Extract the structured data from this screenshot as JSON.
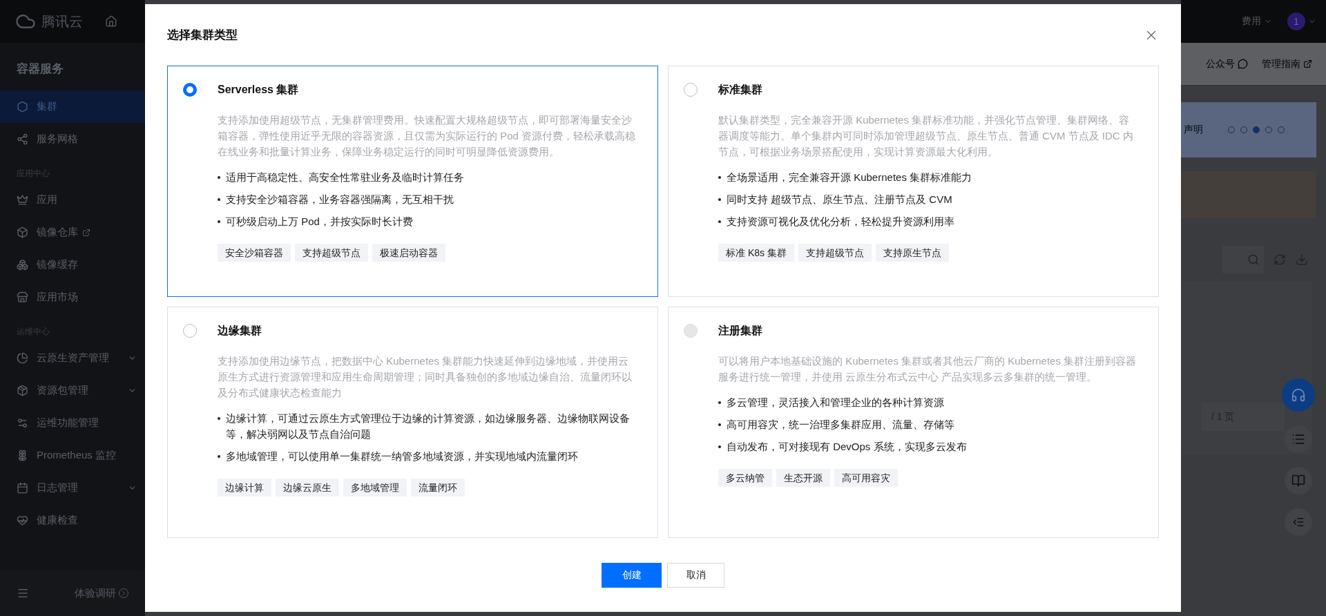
{
  "sidebar": {
    "brand": "腾讯云",
    "title": "容器服务",
    "items": [
      {
        "kind": "item",
        "label": "集群",
        "selected": true,
        "external": false,
        "expandable": false
      },
      {
        "kind": "item",
        "label": "服务网格",
        "selected": false,
        "external": false,
        "expandable": false
      },
      {
        "kind": "group",
        "label": "应用中心"
      },
      {
        "kind": "item",
        "label": "应用",
        "selected": false,
        "external": false,
        "expandable": false
      },
      {
        "kind": "item",
        "label": "镜像仓库",
        "selected": false,
        "external": true,
        "expandable": false
      },
      {
        "kind": "item",
        "label": "镜像缓存",
        "selected": false,
        "external": false,
        "expandable": false
      },
      {
        "kind": "item",
        "label": "应用市场",
        "selected": false,
        "external": false,
        "expandable": false
      },
      {
        "kind": "group",
        "label": "运维中心"
      },
      {
        "kind": "item",
        "label": "云原生资产管理",
        "selected": false,
        "external": false,
        "expandable": true
      },
      {
        "kind": "item",
        "label": "资源包管理",
        "selected": false,
        "external": false,
        "expandable": true
      },
      {
        "kind": "item",
        "label": "运维功能管理",
        "selected": false,
        "external": false,
        "expandable": false
      },
      {
        "kind": "item",
        "label": "Prometheus 监控",
        "selected": false,
        "external": false,
        "expandable": false
      },
      {
        "kind": "item",
        "label": "日志管理",
        "selected": false,
        "external": false,
        "expandable": true
      },
      {
        "kind": "item",
        "label": "健康检查",
        "selected": false,
        "external": false,
        "expandable": false
      }
    ],
    "footer": "体验调研"
  },
  "dialog": {
    "title": "选择集群类型",
    "options": [
      {
        "title": "Serverless 集群",
        "selected": true,
        "disabled": false,
        "description": "支持添加使用超级节点，无集群管理费用。快速配置大规格超级节点，即可部署海量安全沙箱容器，弹性使用近乎无限的容器资源，且仅需为实际运行的 Pod 资源付费，轻松承载高稳在线业务和批量计算业务，保障业务稳定运行的同时可明显降低资源费用。",
        "features": [
          "适用于高稳定性、高安全性常驻业务及临时计算任务",
          "支持安全沙箱容器，业务容器强隔离，无互相干扰",
          "可秒级启动上万 Pod，并按实际时长计费"
        ],
        "tags": [
          "安全沙箱容器",
          "支持超级节点",
          "极速启动容器"
        ]
      },
      {
        "title": "标准集群",
        "selected": false,
        "disabled": false,
        "description": "默认集群类型，完全兼容开源 Kubernetes 集群标准功能，并强化节点管理、集群网络、容器调度等能力。单个集群内可同时添加管理超级节点、原生节点、普通 CVM 节点及 IDC 内节点，可根据业务场景搭配使用，实现计算资源最大化利用。",
        "features": [
          "全场景适用，完全兼容开源 Kubernetes 集群标准能力",
          "同时支持 超级节点、原生节点、注册节点及 CVM",
          "支持资源可视化及优化分析，轻松提升资源利用率"
        ],
        "tags": [
          "标准 K8s 集群",
          "支持超级节点",
          "支持原生节点"
        ]
      },
      {
        "title": "边缘集群",
        "selected": false,
        "disabled": false,
        "description": "支持添加使用边缘节点，把数据中心 Kubernetes 集群能力快速延伸到边缘地域，并使用云原生方式进行资源管理和应用生命周期管理；同时具备独创的多地域边缘自治、流量闭环以及分布式健康状态检查能力",
        "features": [
          "边缘计算，可通过云原生方式管理位于边缘的计算资源，如边缘服务器、边缘物联网设备等，解决弱网以及节点自治问题",
          "多地域管理，可以使用单一集群统一纳管多地域资源，并实现地域内流量闭环"
        ],
        "tags": [
          "边缘计算",
          "边缘云原生",
          "多地域管理",
          "流量闭环"
        ]
      },
      {
        "title": "注册集群",
        "selected": false,
        "disabled": true,
        "description": "可以将用户本地基础设施的 Kubernetes 集群或者其他云厂商的 Kubernetes 集群注册到容器服务进行统一管理，并使用 云原生分布式云中心 产品实现多云多集群的统一管理。",
        "features": [
          "多云管理，灵活接入和管理企业的各种计算资源",
          "高可用容灾，统一治理多集群应用、流量、存储等",
          "自动发布，可对接现有 DevOps 系统，实现多云发布"
        ],
        "tags": [
          "多云纳管",
          "生态开源",
          "高可用容灾"
        ]
      }
    ],
    "buttons": [
      {
        "label": "创建",
        "primary": true
      },
      {
        "label": "取消",
        "primary": false
      }
    ]
  },
  "background": {
    "menu": "费用",
    "avatar": "1",
    "links": [
      {
        "label": "公众号",
        "kind": "chat"
      },
      {
        "label": "管理指南",
        "kind": "external"
      }
    ],
    "notice": "声明",
    "carousel": [
      {
        "selected": false
      },
      {
        "selected": false
      },
      {
        "selected": true
      },
      {
        "selected": false
      },
      {
        "selected": false
      }
    ],
    "pager": "/ 1 页"
  }
}
